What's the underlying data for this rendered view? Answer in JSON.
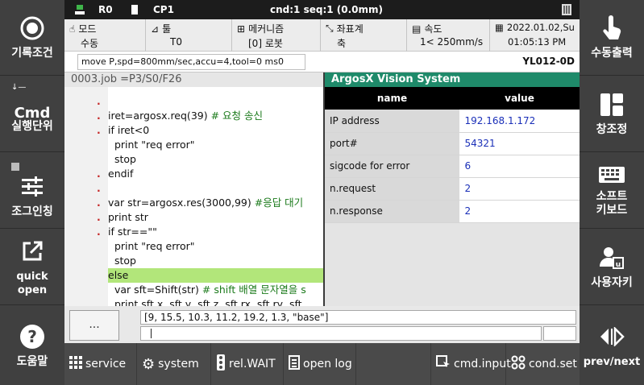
{
  "left_buttons": [
    {
      "label": "기록조건",
      "icon": "record-icon"
    },
    {
      "label": "Cmd",
      "sub": "실행단위",
      "icon": "cmd-icon"
    },
    {
      "label": "조그인칭",
      "icon": "sliders-icon"
    },
    {
      "label": "quick open",
      "icon": "open-external-icon"
    },
    {
      "label": "도움말",
      "icon": "help-icon"
    }
  ],
  "right_buttons": [
    {
      "label": "수동출력",
      "icon": "touch-hand-icon"
    },
    {
      "label": "창조정",
      "icon": "window-layout-icon"
    },
    {
      "label": "소프트\n키보드",
      "icon": "keyboard-icon"
    },
    {
      "label": "사용자키",
      "icon": "user-key-icon"
    },
    {
      "label": "prev/next",
      "icon": "prev-next-icon"
    }
  ],
  "status": {
    "robot": "R0",
    "cp": "CP1",
    "cmd": "cnd:1 seq:1 (0.0mm)"
  },
  "info": {
    "mode_label": "모드",
    "mode_value": "수동",
    "tool_label": "툴",
    "tool_value": "T0",
    "mech_label": "메커니즘",
    "mech_value": "[0] 로봇",
    "coord_label": "좌표계",
    "coord_value": "축",
    "speed_label": "속도",
    "speed_value": "1< 250mm/s",
    "date": "2022.01.02,Su",
    "time": "01:05:13 PM"
  },
  "command": {
    "text": "move P,spd=800mm/sec,accu=4,tool=0 ms0",
    "robot_id": "YL012-0D"
  },
  "job": {
    "header": "0003.job  =P3/S0/F26",
    "lines": [
      {
        "mark": ".",
        "text": ""
      },
      {
        "mark": ".",
        "text": "iret=argosx.req(39) ",
        "comment": "# 요청 송신"
      },
      {
        "mark": ".",
        "text": "if iret<0"
      },
      {
        "mark": "",
        "text": "  print \"req error\""
      },
      {
        "mark": "",
        "text": "  stop"
      },
      {
        "mark": ".",
        "text": "endif"
      },
      {
        "mark": ".",
        "text": ""
      },
      {
        "mark": ".",
        "text": "var str=argosx.res(3000,99) ",
        "comment": "#응답 대기"
      },
      {
        "mark": ".",
        "text": "print str"
      },
      {
        "mark": ".",
        "text": "if str==\"\""
      },
      {
        "mark": "",
        "text": "  print \"req error\""
      },
      {
        "mark": "",
        "text": "  stop"
      },
      {
        "mark": "",
        "text": "else",
        "highlight": true
      },
      {
        "mark": "",
        "text": "  var sft=Shift(str) ",
        "comment": "# shift 배열 문자열을 s"
      },
      {
        "mark": "",
        "text": "  print sft.x, sft.y, sft.z, sft.rx, sft.ry, sft"
      }
    ]
  },
  "vision": {
    "title": "ArgosX Vision System",
    "col_name": "name",
    "col_value": "value",
    "rows": [
      {
        "name": "IP address",
        "value": "192.168.1.172"
      },
      {
        "name": "port#",
        "value": "54321"
      },
      {
        "name": "sigcode for error",
        "value": "6"
      },
      {
        "name": "n.request",
        "value": "2"
      },
      {
        "name": "n.response",
        "value": "2"
      }
    ]
  },
  "bottom": {
    "ellipsis": "...",
    "output": "[9, 15.5, 10.3, 11.2, 19.2, 1.3, \"base\"]"
  },
  "toolbar": [
    {
      "label": "service",
      "icon": "grid-icon"
    },
    {
      "label": "system",
      "icon": "gear-icon"
    },
    {
      "label": "rel.WAIT",
      "icon": "traffic-light-icon"
    },
    {
      "label": "open log",
      "icon": "log-icon"
    },
    {
      "label": "cmd.input",
      "icon": "cmd-input-icon"
    },
    {
      "label": "cond.set",
      "icon": "cond-set-icon"
    }
  ]
}
